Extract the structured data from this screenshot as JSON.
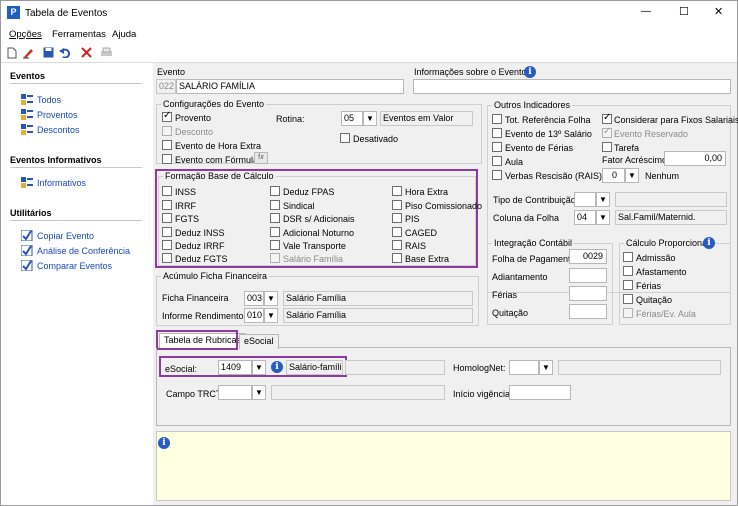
{
  "window": {
    "title": "Tabela de Eventos",
    "controls": {
      "minimize": "—",
      "maximize": "☐",
      "close": "✕"
    }
  },
  "menu": {
    "items": [
      "Opções",
      "Ferramentas",
      "Ajuda"
    ]
  },
  "toolbar": {
    "icons": [
      "new-doc-icon",
      "edit-icon",
      "save-icon",
      "undo-icon",
      "delete-icon",
      "print-icon"
    ]
  },
  "sidebar": {
    "eventos": {
      "title": "Eventos",
      "items": [
        "Todos",
        "Proventos",
        "Descontos"
      ]
    },
    "informativos": {
      "title": "Eventos Informativos",
      "items": [
        "Informativos"
      ]
    },
    "utilitarios": {
      "title": "Utilitários",
      "items": [
        "Copiar Evento",
        "Análise de Conferência",
        "Comparar Eventos"
      ]
    }
  },
  "evento": {
    "label": "Evento",
    "code": "022",
    "name": "SALÁRIO FAMÍLIA",
    "info_label": "Informações sobre o Evento",
    "info_value": ""
  },
  "config": {
    "title": "Configurações do Evento",
    "proventos": "Provento",
    "desconto": "Desconto",
    "hora_extra": "Evento de Hora Extra",
    "formula": "Evento com Fórmula",
    "formula_btn": "f𝑥",
    "rotina_label": "Rotina:",
    "rotina_code": "05",
    "rotina_desc": "Eventos em Valor",
    "desativado": "Desativado"
  },
  "formacao": {
    "title": "Formação Base de Cálculo",
    "col1": [
      "INSS",
      "IRRF",
      "FGTS",
      "Deduz INSS",
      "Deduz IRRF",
      "Deduz FGTS"
    ],
    "col2": [
      "Deduz FPAS",
      "Sindical",
      "DSR s/ Adicionais",
      "Adicional Noturno",
      "Vale Transporte",
      "Salário Família"
    ],
    "col3": [
      "Hora Extra",
      "Piso Comissionado",
      "PIS",
      "CAGED",
      "RAIS",
      "Base Extra"
    ]
  },
  "acumulo": {
    "title": "Acúmulo Ficha Financeira",
    "ficha_label": "Ficha Financeira",
    "ficha_code": "003",
    "ficha_desc": "Salário Família",
    "informe_label": "Informe Rendimentos",
    "informe_code": "010",
    "informe_desc": "Salário Família"
  },
  "outros": {
    "title": "Outros Indicadores",
    "tot_ref": "Tot. Referência Folha",
    "considerar": "Considerar para Fixos Salariais",
    "decimo": "Evento de 13º Salário",
    "reservado": "Evento Reservado",
    "ferias": "Evento de Férias",
    "tarefa": "Tarefa",
    "aula": "Aula",
    "fator_label": "Fator Acréscimo",
    "fator_value": "0,00",
    "verbas": "Verbas Rescisão (RAIS)",
    "verbas_code": "0",
    "verbas_desc": "Nenhum",
    "tipo_label": "Tipo de Contribuição",
    "coluna_label": "Coluna da Folha",
    "coluna_code": "04",
    "coluna_desc": "Sal.Famil/Maternid."
  },
  "integracao": {
    "title": "Integração Contábil",
    "folha_label": "Folha de Pagamento",
    "folha_value": "0029",
    "adiantamento": "Adiantamento",
    "ferias": "Férias",
    "quitacao": "Quitação"
  },
  "calculo": {
    "title": "Cálculo Proporcional",
    "items": [
      "Admissão",
      "Afastamento",
      "Férias",
      "Quitação",
      "Férias/Ev. Aula"
    ]
  },
  "tabs": [
    "Tabela de Rubricas",
    "eSocial"
  ],
  "rubricas": {
    "esocial_label": "eSocial:",
    "esocial_code": "1409",
    "esocial_desc": "Salário-família",
    "homolog_label": "HomologNet:",
    "trct_label": "Campo TRCT:",
    "vigencia_label": "Início vigência:"
  },
  "colors": {
    "accent": "#8e3aa0",
    "link": "#1a47b8",
    "note_bg": "#ffffe1"
  }
}
